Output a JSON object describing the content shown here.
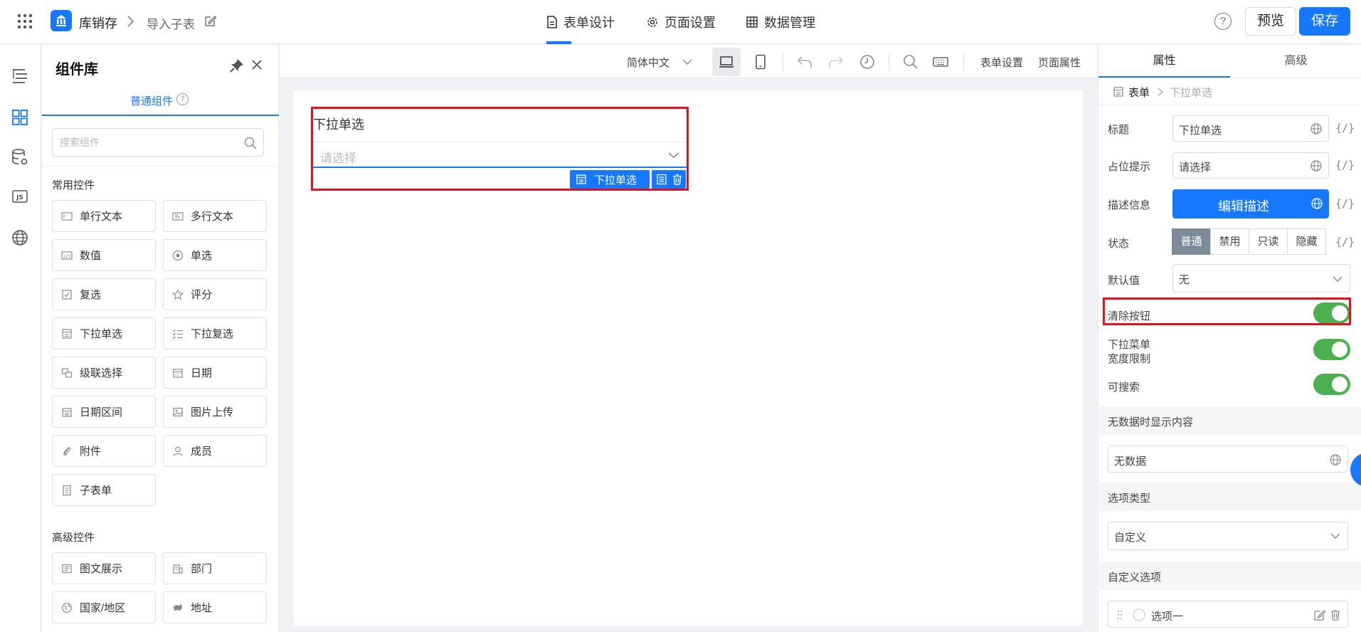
{
  "header": {
    "app_name": "库销存",
    "page_name": "导入子表",
    "tabs": [
      {
        "label": "表单设计",
        "icon": "document-icon",
        "active": true
      },
      {
        "label": "页面设置",
        "icon": "gear-icon",
        "active": false
      },
      {
        "label": "数据管理",
        "icon": "table-icon",
        "active": false
      }
    ],
    "help": "?",
    "preview_label": "预览",
    "save_label": "保存",
    "accent": "#1677ff"
  },
  "library": {
    "title": "组件库",
    "tab_label": "普通组件",
    "tab_help": "?",
    "search_placeholder": "搜索组件",
    "common_title": "常用控件",
    "common": [
      {
        "label": "单行文本",
        "icon": "single-line-text-icon"
      },
      {
        "label": "多行文本",
        "icon": "multi-line-text-icon"
      },
      {
        "label": "数值",
        "icon": "number-icon"
      },
      {
        "label": "单选",
        "icon": "radio-icon"
      },
      {
        "label": "复选",
        "icon": "checkbox-icon"
      },
      {
        "label": "评分",
        "icon": "star-icon"
      },
      {
        "label": "下拉单选",
        "icon": "dropdown-single-icon"
      },
      {
        "label": "下拉复选",
        "icon": "dropdown-multi-icon"
      },
      {
        "label": "级联选择",
        "icon": "cascade-icon"
      },
      {
        "label": "日期",
        "icon": "calendar-icon"
      },
      {
        "label": "日期区间",
        "icon": "date-range-icon"
      },
      {
        "label": "图片上传",
        "icon": "image-icon"
      },
      {
        "label": "附件",
        "icon": "paperclip-icon"
      },
      {
        "label": "成员",
        "icon": "user-icon"
      },
      {
        "label": "子表单",
        "icon": "subform-icon"
      }
    ],
    "advanced_title": "高级控件",
    "advanced": [
      {
        "label": "图文展示",
        "icon": "rich-text-icon"
      },
      {
        "label": "部门",
        "icon": "department-icon"
      },
      {
        "label": "国家/地区",
        "icon": "globe-icon"
      },
      {
        "label": "地址",
        "icon": "map-icon"
      }
    ]
  },
  "toolbar": {
    "language": "简体中文",
    "form_settings": "表单设置",
    "page_props": "页面属性"
  },
  "canvas": {
    "field_label": "下拉单选",
    "field_placeholder": "请选择",
    "field_tag": "下拉单选"
  },
  "props": {
    "tabs": [
      "属性",
      "高级"
    ],
    "breadcrumb": [
      "表单",
      "下拉单选"
    ],
    "title_label": "标题",
    "title_value": "下拉单选",
    "placeholder_label": "占位提示",
    "placeholder_value": "请选择",
    "desc_label": "描述信息",
    "desc_button": "编辑描述",
    "expr": "{/}",
    "status_label": "状态",
    "status_options": [
      "普通",
      "禁用",
      "只读",
      "隐藏"
    ],
    "default_label": "默认值",
    "default_value": "无",
    "clear_label": "清除按钮",
    "width_limit_label_1": "下拉菜单",
    "width_limit_label_2": "宽度限制",
    "searchable_label": "可搜索",
    "no_data_title": "无数据时显示内容",
    "no_data_value": "无数据",
    "option_type_title": "选项类型",
    "option_type_value": "自定义",
    "custom_options_title": "自定义选项",
    "option_1": "选项一",
    "toggle_color": "#4caf50",
    "highlight_color": "#e0121f"
  }
}
